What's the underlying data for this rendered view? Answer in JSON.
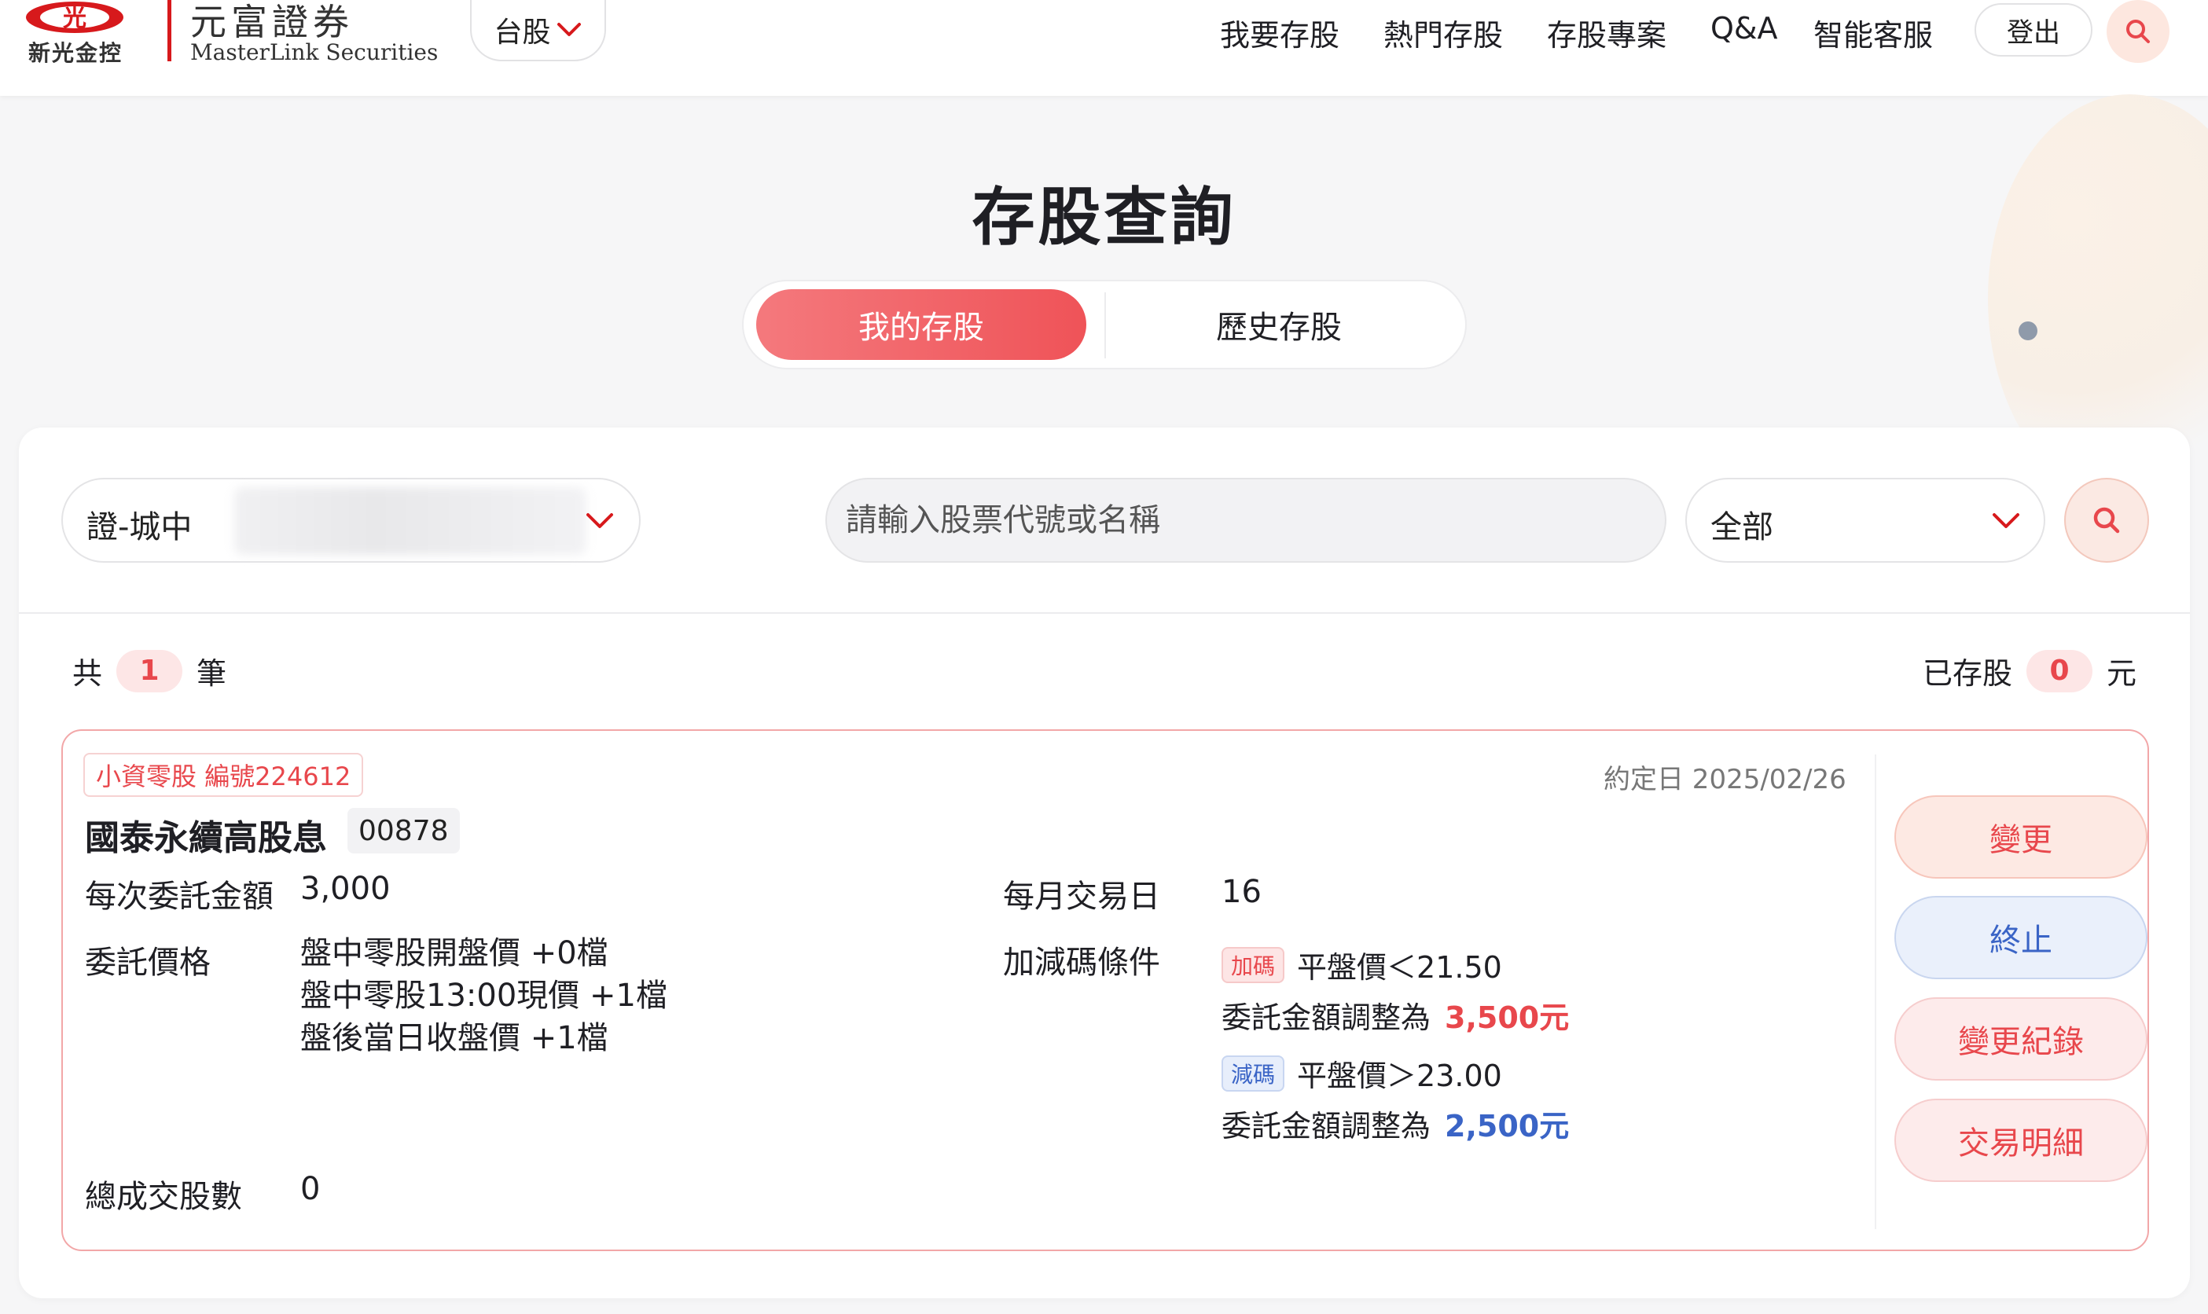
{
  "header": {
    "logo": {
      "emblem_text": "光",
      "group_name": "新光金控",
      "brand_name": "元富證券",
      "brand_en": "MasterLink Securities"
    },
    "market_selector": {
      "value": "台股",
      "icon": "chevron-down-icon"
    },
    "nav": [
      {
        "label": "我要存股"
      },
      {
        "label": "熱門存股"
      },
      {
        "label": "存股專案"
      },
      {
        "label": "Q&A"
      },
      {
        "label": "智能客服"
      }
    ],
    "logout_label": "登出",
    "search_icon": "search-icon"
  },
  "page": {
    "title": "存股查詢",
    "tabs": [
      {
        "label": "我的存股",
        "active": true
      },
      {
        "label": "歷史存股",
        "active": false
      }
    ]
  },
  "filters": {
    "account": {
      "value": "證-城中"
    },
    "search": {
      "placeholder": "請輸入股票代號或名稱",
      "value": ""
    },
    "type": {
      "value": "全部"
    }
  },
  "summary": {
    "total_prefix": "共",
    "total_count": "1",
    "total_suffix": "筆",
    "saved_prefix": "已存股",
    "saved_amount": "0",
    "saved_suffix": "元"
  },
  "card": {
    "tag": "小資零股 編號224612",
    "date_label": "約定日 2025/02/26",
    "stock_name": "國泰永續高股息",
    "stock_code": "00878",
    "fields": {
      "amount_label": "每次委託金額",
      "amount_value": "3,000",
      "trade_day_label": "每月交易日",
      "trade_day_value": "16",
      "price_label": "委託價格",
      "price_values": [
        "盤中零股開盤價 +0檔",
        "盤中零股13:00現價 +1檔",
        "盤後當日收盤價 +1檔"
      ],
      "condition_label": "加減碼條件",
      "total_shares_label": "總成交股數",
      "total_shares_value": "0"
    },
    "conditions": {
      "add_badge": "加碼",
      "add_rule": "平盤價＜21.50",
      "add_amount_label": "委託金額調整為",
      "add_amount_value": "3,500元",
      "sub_badge": "減碼",
      "sub_rule": "平盤價＞23.00",
      "sub_amount_label": "委託金額調整為",
      "sub_amount_value": "2,500元"
    },
    "actions": [
      {
        "label": "變更"
      },
      {
        "label": "終止"
      },
      {
        "label": "變更紀錄"
      },
      {
        "label": "交易明細"
      }
    ]
  },
  "colors": {
    "accent_red": "#e8474c",
    "accent_blue": "#3a64c6",
    "tab_gradient_start": "#f4797d",
    "tab_gradient_end": "#ef5358"
  }
}
